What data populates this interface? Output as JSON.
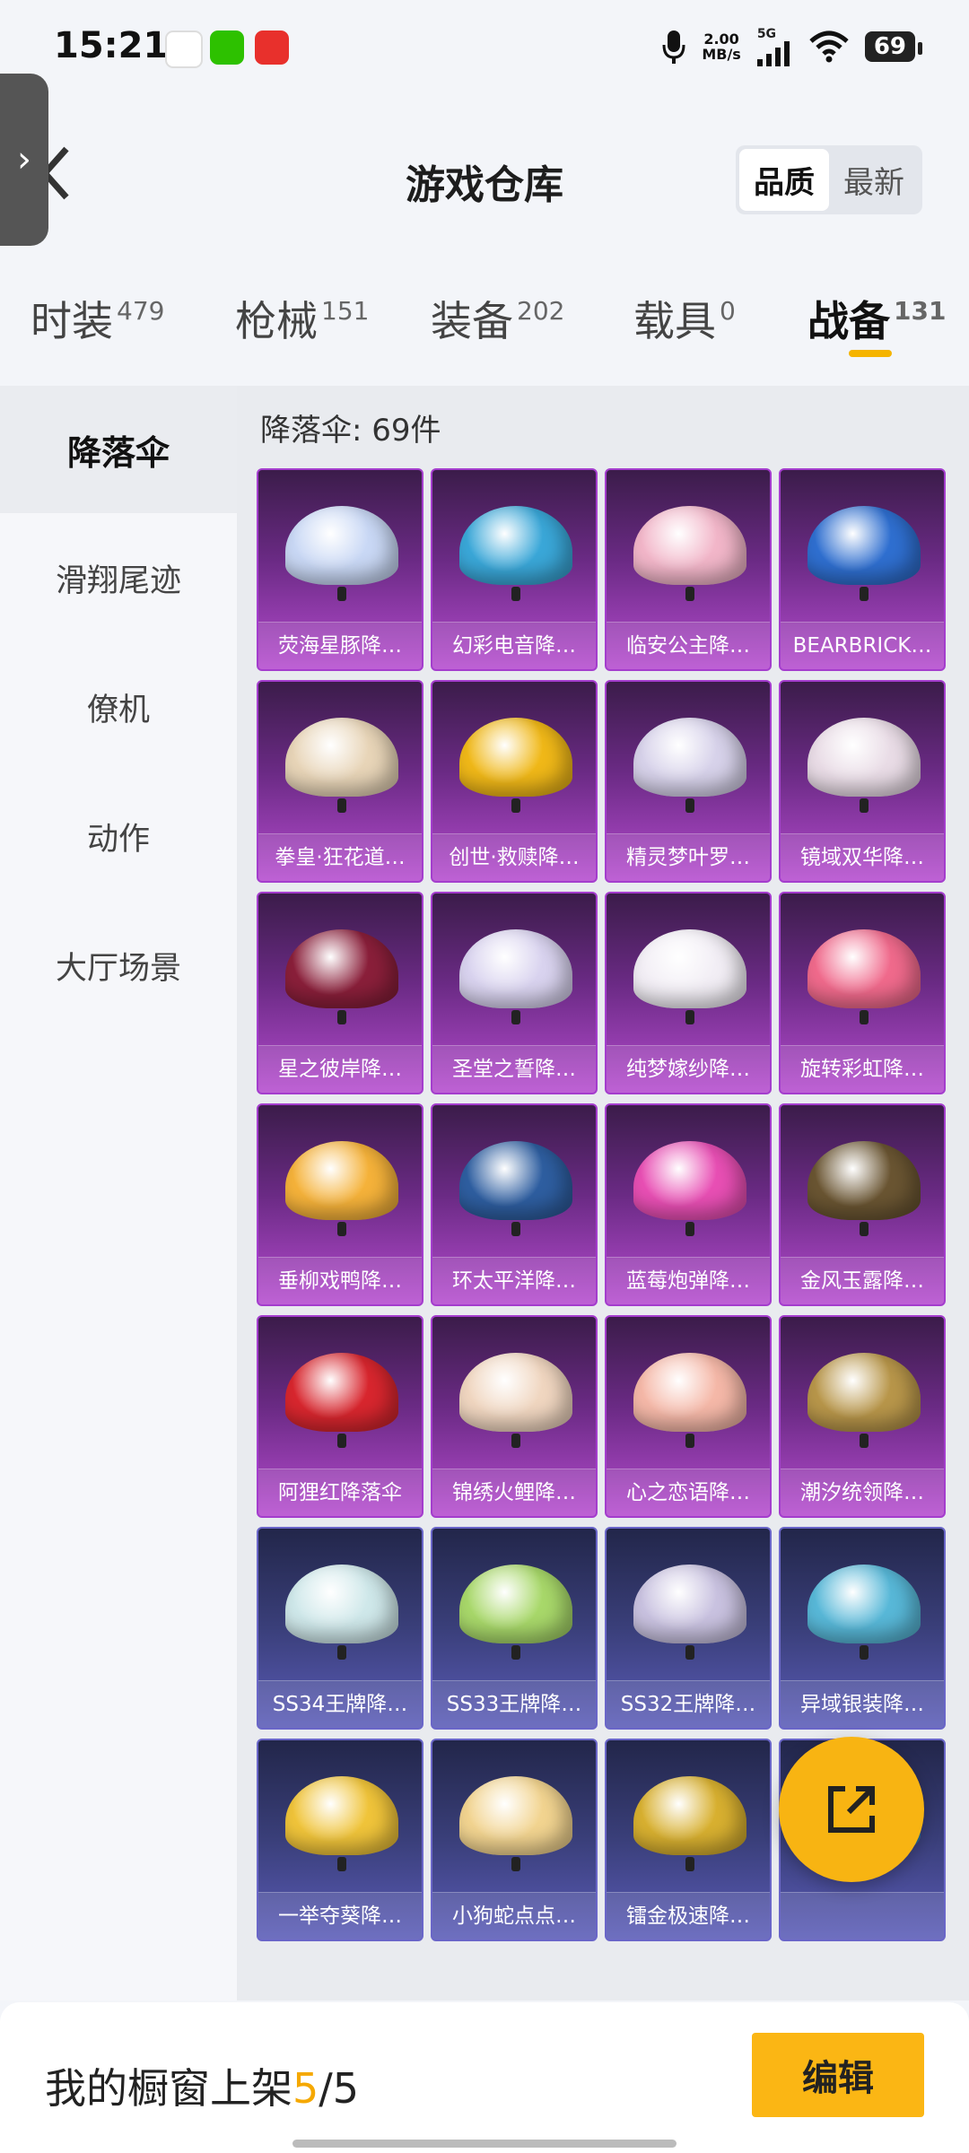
{
  "status_bar": {
    "time": "15:21",
    "net_speed_value": "2.00",
    "net_speed_unit": "MB/s",
    "network": "5G",
    "battery": "69"
  },
  "header": {
    "title": "游戏仓库",
    "sort_options": [
      "品质",
      "最新"
    ],
    "sort_active": "品质"
  },
  "tabs": [
    {
      "label": "时装",
      "count": "479"
    },
    {
      "label": "枪械",
      "count": "151"
    },
    {
      "label": "装备",
      "count": "202"
    },
    {
      "label": "载具",
      "count": "0"
    },
    {
      "label": "战备",
      "count": "131"
    }
  ],
  "sidebar": {
    "items": [
      "降落伞",
      "滑翔尾迹",
      "僚机",
      "动作",
      "大厅场景"
    ]
  },
  "content": {
    "count_label": "降落伞: 69件",
    "items": [
      {
        "name": "荧海星豚降…",
        "tier": "purple",
        "color": "#c9d8f5"
      },
      {
        "name": "幻彩电音降…",
        "tier": "purple",
        "color": "#3aa7d8"
      },
      {
        "name": "临安公主降…",
        "tier": "purple",
        "color": "#f2b6c9"
      },
      {
        "name": "BEARBRICK…",
        "tier": "purple",
        "color": "#2f6fd0"
      },
      {
        "name": "拳皇·狂花道…",
        "tier": "purple",
        "color": "#e8d5b8"
      },
      {
        "name": "创世·救赎降…",
        "tier": "purple",
        "color": "#f0b818"
      },
      {
        "name": "精灵梦叶罗…",
        "tier": "purple",
        "color": "#d7d2ea"
      },
      {
        "name": "镜域双华降…",
        "tier": "purple",
        "color": "#e9dce6"
      },
      {
        "name": "星之彼岸降…",
        "tier": "purple",
        "color": "#8a1f3a"
      },
      {
        "name": "圣堂之誓降…",
        "tier": "purple",
        "color": "#d9d3ef"
      },
      {
        "name": "纯梦嫁纱降…",
        "tier": "purple",
        "color": "#f2eef5"
      },
      {
        "name": "旋转彩虹降…",
        "tier": "purple",
        "color": "#f06a8c"
      },
      {
        "name": "垂柳戏鸭降…",
        "tier": "purple",
        "color": "#f5b23a"
      },
      {
        "name": "环太平洋降…",
        "tier": "purple",
        "color": "#2e5ea0"
      },
      {
        "name": "蓝莓炮弹降…",
        "tier": "purple",
        "color": "#e84fb4"
      },
      {
        "name": "金风玉露降…",
        "tier": "purple",
        "color": "#6a5532"
      },
      {
        "name": "阿狸红降落伞",
        "tier": "purple",
        "color": "#d8262e"
      },
      {
        "name": "锦绣火鲤降…",
        "tier": "purple",
        "color": "#f0d6c0"
      },
      {
        "name": "心之恋语降…",
        "tier": "purple",
        "color": "#f5b8a8"
      },
      {
        "name": "潮汐统领降…",
        "tier": "purple",
        "color": "#b8964a"
      },
      {
        "name": "SS34王牌降…",
        "tier": "blue",
        "color": "#cfe8ea"
      },
      {
        "name": "SS33王牌降…",
        "tier": "blue",
        "color": "#a8d86a"
      },
      {
        "name": "SS32王牌降…",
        "tier": "blue",
        "color": "#c9c2e0"
      },
      {
        "name": "异域银装降…",
        "tier": "blue",
        "color": "#58b8d8"
      },
      {
        "name": "一举夺葵降…",
        "tier": "blue",
        "color": "#f0c43a"
      },
      {
        "name": "小狗蛇点点…",
        "tier": "blue",
        "color": "#f2d490"
      },
      {
        "name": "镭金极速降…",
        "tier": "blue",
        "color": "#d8b030"
      },
      {
        "name": "",
        "tier": "blue",
        "color": "#3a9ad8"
      }
    ]
  },
  "bottom_bar": {
    "showcase_prefix": "我的橱窗上架",
    "showcase_count": "5",
    "showcase_total": "/5",
    "edit_label": "编辑"
  }
}
